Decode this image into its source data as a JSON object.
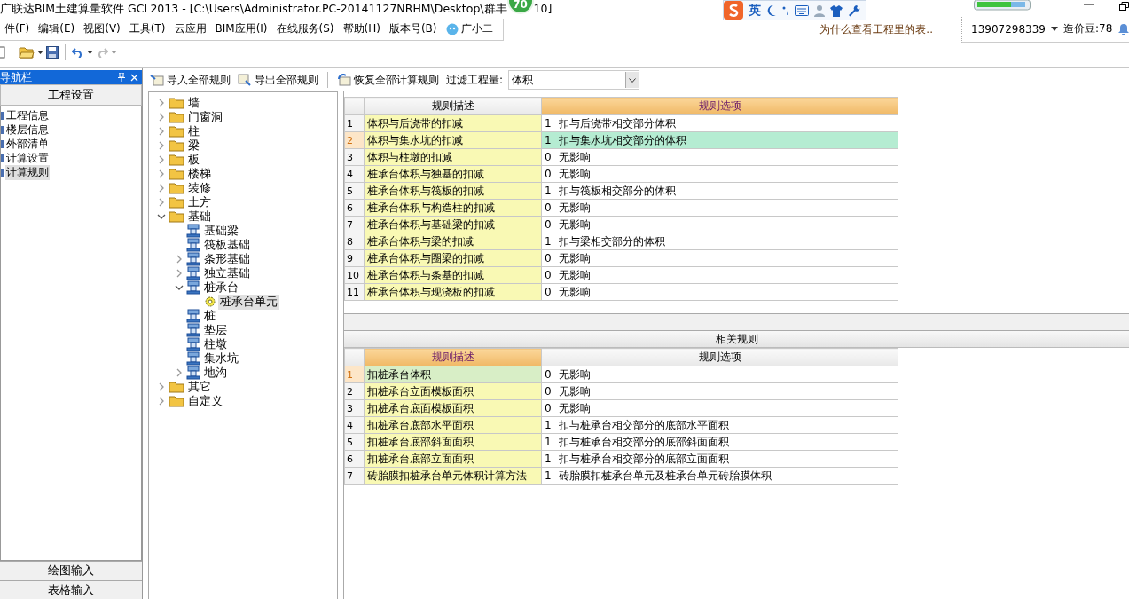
{
  "window": {
    "title": "广联达BIM土建算量软件 GCL2013 - [C:\\Users\\Administrator.PC-20141127NRHM\\Desktop\\群丰",
    "title_tail": "10]",
    "badge": "70"
  },
  "ime_bar": {
    "mode": "英"
  },
  "menu": [
    "件(F)",
    "编辑(E)",
    "视图(V)",
    "工具(T)",
    "云应用",
    "BIM应用(I)",
    "在线服务(S)",
    "帮助(H)",
    "版本号(B)",
    "广小二"
  ],
  "hint": "为什么查看工程里的表..",
  "account": {
    "phone": "13907298339",
    "beans": "造价豆:78"
  },
  "nav": {
    "title": "导航栏",
    "section": "工程设置",
    "items": [
      {
        "label": "工程信息",
        "selected": false
      },
      {
        "label": "楼层信息",
        "selected": false
      },
      {
        "label": "外部清单",
        "selected": false
      },
      {
        "label": "计算设置",
        "selected": false
      },
      {
        "label": "计算规则",
        "selected": true
      }
    ],
    "bottom_buttons": [
      "绘图输入",
      "表格输入"
    ]
  },
  "rules_toolbar": {
    "buttons": [
      "导入全部规则",
      "导出全部规则",
      "恢复全部计算规则"
    ],
    "filter_label": "过滤工程量:",
    "filter_value": "体积"
  },
  "tree": [
    {
      "label": "墙",
      "kind": "folder",
      "expanded": false,
      "selected": false
    },
    {
      "label": "门窗洞",
      "kind": "folder",
      "expanded": false,
      "selected": false
    },
    {
      "label": "柱",
      "kind": "folder",
      "expanded": false,
      "selected": false
    },
    {
      "label": "梁",
      "kind": "folder",
      "expanded": false,
      "selected": false
    },
    {
      "label": "板",
      "kind": "folder",
      "expanded": false,
      "selected": false
    },
    {
      "label": "楼梯",
      "kind": "folder",
      "expanded": false,
      "selected": false
    },
    {
      "label": "装修",
      "kind": "folder",
      "expanded": false,
      "selected": false
    },
    {
      "label": "土方",
      "kind": "folder",
      "expanded": false,
      "selected": false
    },
    {
      "label": "基础",
      "kind": "folder",
      "expanded": true,
      "selected": false,
      "children": [
        {
          "label": "基础梁",
          "kind": "component",
          "selected": false
        },
        {
          "label": "筏板基础",
          "kind": "component",
          "selected": false
        },
        {
          "label": "条形基础",
          "kind": "component",
          "expanded": false,
          "selected": false
        },
        {
          "label": "独立基础",
          "kind": "component",
          "expanded": false,
          "selected": false
        },
        {
          "label": "桩承台",
          "kind": "component",
          "expanded": true,
          "selected": false,
          "children": [
            {
              "label": "桩承台单元",
              "kind": "unit",
              "selected": true
            }
          ]
        },
        {
          "label": "桩",
          "kind": "component",
          "selected": false
        },
        {
          "label": "垫层",
          "kind": "component",
          "selected": false
        },
        {
          "label": "柱墩",
          "kind": "component",
          "selected": false
        },
        {
          "label": "集水坑",
          "kind": "component",
          "selected": false
        },
        {
          "label": "地沟",
          "kind": "component",
          "expanded": false,
          "selected": false
        }
      ]
    },
    {
      "label": "其它",
      "kind": "folder",
      "expanded": false,
      "selected": false
    },
    {
      "label": "自定义",
      "kind": "folder",
      "expanded": false,
      "selected": false
    }
  ],
  "rules_table": {
    "columns": [
      {
        "label": "规则描述",
        "active": false
      },
      {
        "label": "规则选项",
        "active": true
      }
    ],
    "rows": [
      {
        "no": "1",
        "desc": "体积与后浇带的扣减",
        "value": "1",
        "option": "扣与后浇带相交部分体积",
        "selected": false
      },
      {
        "no": "2",
        "desc": "体积与集水坑的扣减",
        "value": "1",
        "option": "扣与集水坑相交部分的体积",
        "selected": true
      },
      {
        "no": "3",
        "desc": "体积与柱墩的扣减",
        "value": "0",
        "option": "无影响",
        "selected": false
      },
      {
        "no": "4",
        "desc": "桩承台体积与独基的扣减",
        "value": "0",
        "option": "无影响",
        "selected": false
      },
      {
        "no": "5",
        "desc": "桩承台体积与筏板的扣减",
        "value": "1",
        "option": "扣与筏板相交部分的体积",
        "selected": false
      },
      {
        "no": "6",
        "desc": "桩承台体积与构造柱的扣减",
        "value": "0",
        "option": "无影响",
        "selected": false
      },
      {
        "no": "7",
        "desc": "桩承台体积与基础梁的扣减",
        "value": "0",
        "option": "无影响",
        "selected": false
      },
      {
        "no": "8",
        "desc": "桩承台体积与梁的扣减",
        "value": "1",
        "option": "扣与梁相交部分的体积",
        "selected": false
      },
      {
        "no": "9",
        "desc": "桩承台体积与圈梁的扣减",
        "value": "0",
        "option": "无影响",
        "selected": false
      },
      {
        "no": "10",
        "desc": "桩承台体积与条基的扣减",
        "value": "0",
        "option": "无影响",
        "selected": false
      },
      {
        "no": "11",
        "desc": "桩承台体积与现浇板的扣减",
        "value": "0",
        "option": "无影响",
        "selected": false
      }
    ]
  },
  "related": {
    "title": "相关规则",
    "columns": [
      {
        "label": "规则描述",
        "active": true
      },
      {
        "label": "规则选项",
        "active": false
      }
    ],
    "rows": [
      {
        "no": "1",
        "desc": "扣桩承台体积",
        "value": "0",
        "option": "无影响",
        "selected": true
      },
      {
        "no": "2",
        "desc": "扣桩承台立面模板面积",
        "value": "0",
        "option": "无影响",
        "selected": false
      },
      {
        "no": "3",
        "desc": "扣桩承台底面模板面积",
        "value": "0",
        "option": "无影响",
        "selected": false
      },
      {
        "no": "4",
        "desc": "扣桩承台底部水平面积",
        "value": "1",
        "option": "扣与桩承台相交部分的底部水平面积",
        "selected": false
      },
      {
        "no": "5",
        "desc": "扣桩承台底部斜面面积",
        "value": "1",
        "option": "扣与桩承台相交部分的底部斜面面积",
        "selected": false
      },
      {
        "no": "6",
        "desc": "扣桩承台底部立面面积",
        "value": "1",
        "option": "扣与桩承台相交部分的底部立面面积",
        "selected": false
      },
      {
        "no": "7",
        "desc": "砖胎膜扣桩承台单元体积计算方法",
        "value": "1",
        "option": "砖胎膜扣桩承台单元及桩承台单元砖胎膜体积",
        "selected": false
      }
    ]
  }
}
